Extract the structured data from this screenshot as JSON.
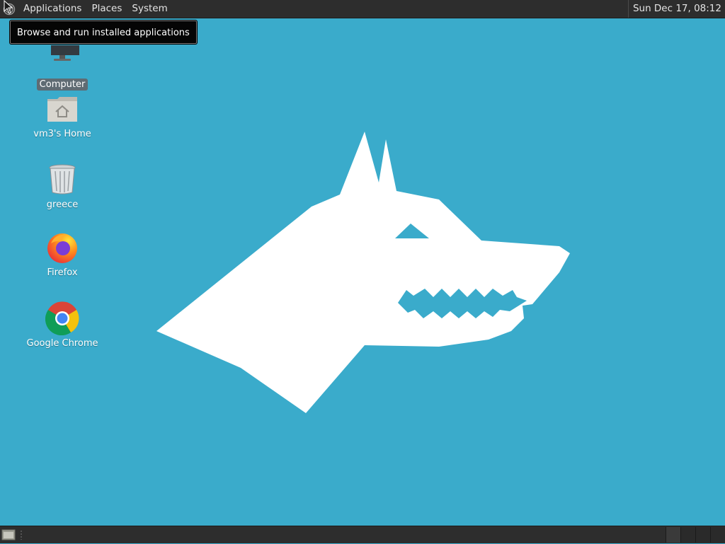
{
  "top_panel": {
    "menus": [
      "Applications",
      "Places",
      "System"
    ],
    "clock": "Sun Dec 17, 08:12",
    "logo_icon": "distro-spiral-icon"
  },
  "tooltip": "Browse and run installed applications",
  "desktop_icons": [
    {
      "label": "Computer",
      "icon": "computer-monitor-icon",
      "selected": true
    },
    {
      "label": "vm3's Home",
      "icon": "home-folder-icon",
      "selected": false
    },
    {
      "label": "greece",
      "icon": "trash-can-icon",
      "selected": false
    },
    {
      "label": "Firefox",
      "icon": "firefox-icon",
      "selected": false
    },
    {
      "label": "Google Chrome",
      "icon": "chrome-icon",
      "selected": false
    }
  ],
  "colors": {
    "desktop_bg": "#3aabcb",
    "panel_bg": "#2d2d2d",
    "wallpaper_wolf": "#ffffff"
  },
  "bottom_panel": {
    "workspace_count": 4,
    "active_workspace": 1
  }
}
